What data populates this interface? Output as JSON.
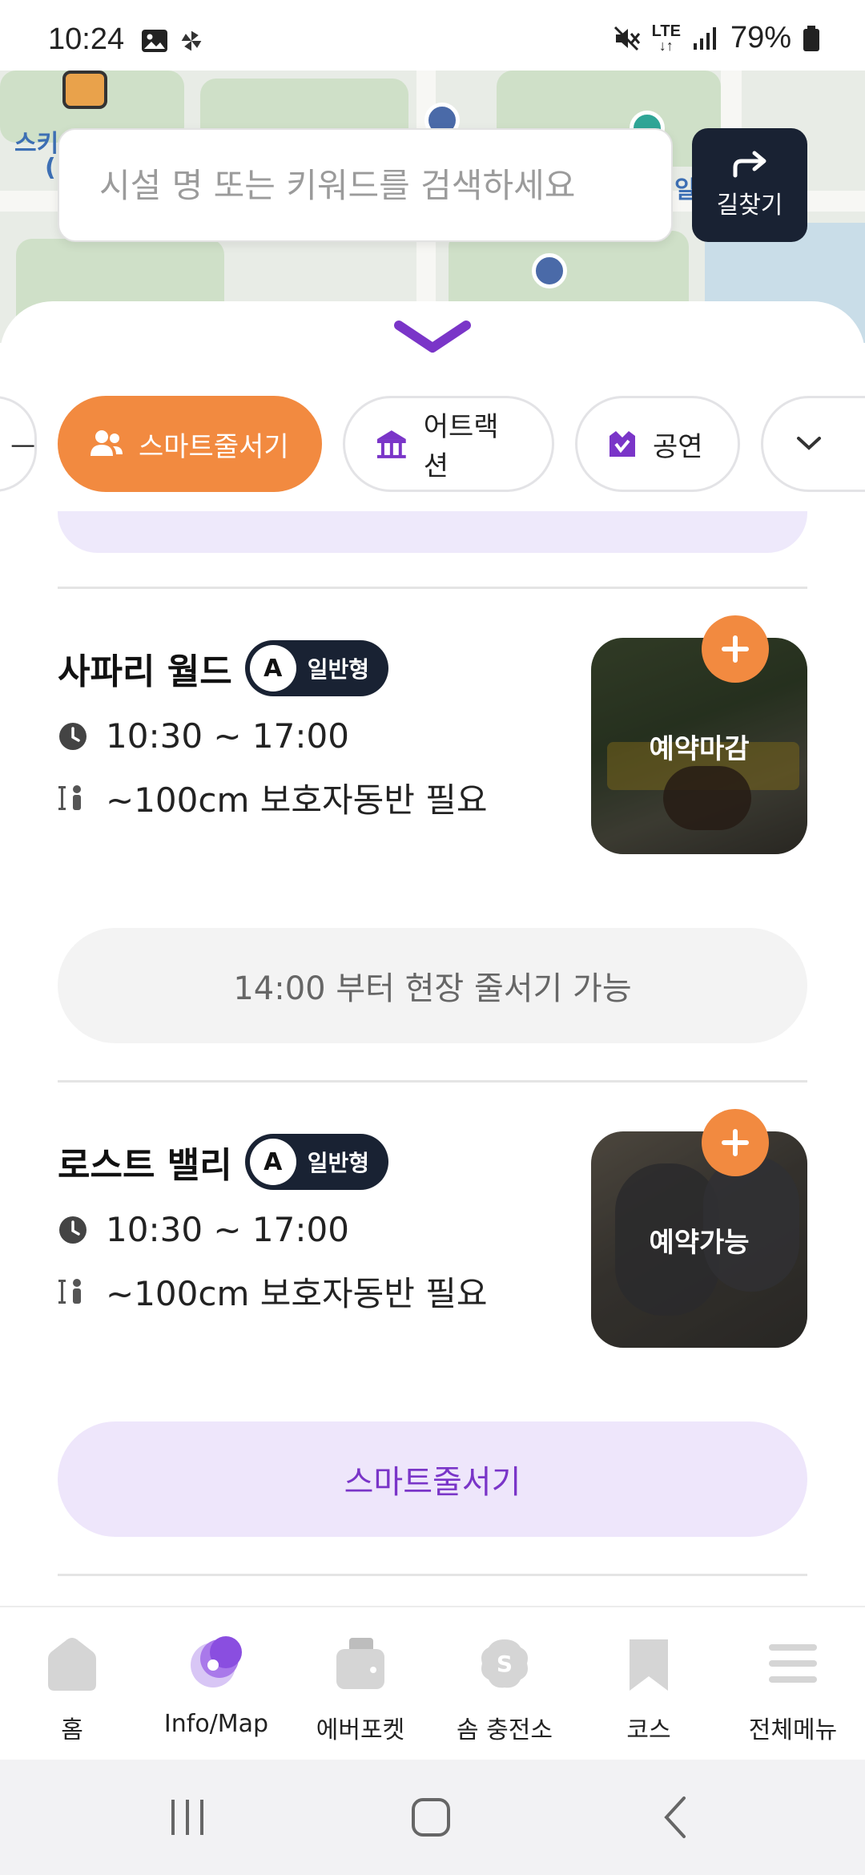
{
  "status_bar": {
    "time": "10:24",
    "lte": "LTE",
    "battery": "79%"
  },
  "map": {
    "label_1": "스키",
    "label_2": "(",
    "label_3": "일."
  },
  "search": {
    "placeholder": "시설 명 또는 키워드를 검색하세요",
    "route_label": "길찾기"
  },
  "chips": [
    {
      "label": "스마트줄서기",
      "active": true
    },
    {
      "label": "어트랙션"
    },
    {
      "label": "공연"
    }
  ],
  "rides": [
    {
      "name": "사파리 월드",
      "badge_letter": "A",
      "badge_text": "일반형",
      "hours": "10:30 ~ 17:00",
      "height": "~100cm 보호자동반 필요",
      "status": "예약마감",
      "button": "14:00 부터 현장 줄서기 가능"
    },
    {
      "name": "로스트 밸리",
      "badge_letter": "A",
      "badge_text": "일반형",
      "hours": "10:30 ~ 17:00",
      "height": "~100cm 보호자동반 필요",
      "status": "예약가능",
      "button": "스마트줄서기"
    }
  ],
  "bottom_nav": [
    {
      "label": "홈",
      "icon": "home-icon"
    },
    {
      "label": "Info/Map",
      "icon": "map-icon"
    },
    {
      "label": "에버포켓",
      "icon": "wallet-icon"
    },
    {
      "label": "솜 충전소",
      "icon": "charge-icon"
    },
    {
      "label": "코스",
      "icon": "bookmark-icon"
    },
    {
      "label": "전체메뉴",
      "icon": "menu-icon"
    }
  ],
  "colors": {
    "accent_orange": "#f28a40",
    "navy": "#192233",
    "purple": "#7a35c8",
    "purple_light": "#eee6fb"
  }
}
